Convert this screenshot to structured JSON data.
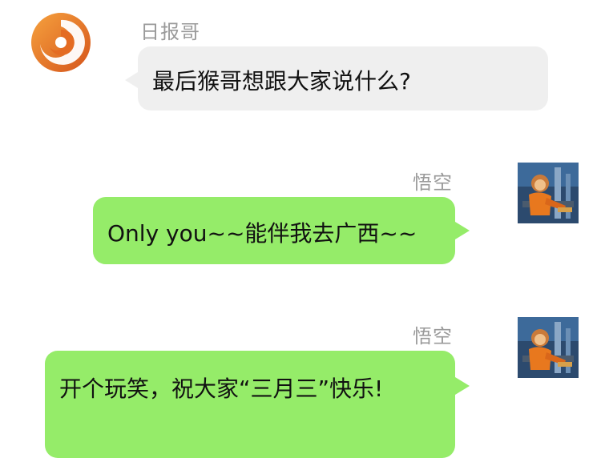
{
  "messages": [
    {
      "sender": "日报哥",
      "text": "最后猴哥想跟大家说什么?",
      "side": "left",
      "avatar": "orange-swirl-logo-icon"
    },
    {
      "sender": "悟空",
      "text": "Only you~~能伴我去广西~~",
      "side": "right",
      "avatar": "monkey-king-avatar"
    },
    {
      "sender": "悟空",
      "text": "开个玩笑，祝大家“三月三”快乐!",
      "side": "right",
      "avatar": "monkey-king-avatar"
    }
  ],
  "colors": {
    "incoming_bubble": "#efefef",
    "outgoing_bubble": "#95ec69",
    "sender_name": "#9a9a9a",
    "logo_orange": "#e8782a"
  }
}
